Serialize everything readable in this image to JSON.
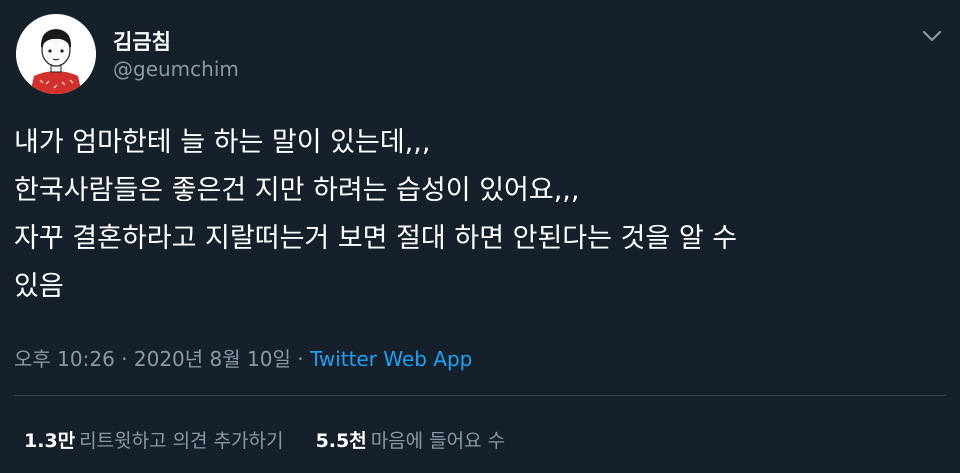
{
  "author": {
    "display_name": "김금침",
    "handle": "@geumchim"
  },
  "tweet": {
    "lines": [
      "내가 엄마한테 늘 하는 말이 있는데,,,",
      "한국사람들은 좋은건 지만 하려는 습성이 있어요,,,",
      "자꾸 결혼하라고 지랄떠는거 보면 절대 하면 안된다는 것을 알 수",
      "있음"
    ]
  },
  "meta": {
    "time": "오후 10:26",
    "separator": "·",
    "date": "2020년 8월 10일",
    "source": "Twitter Web App"
  },
  "stats": {
    "retweets_count": "1.3만",
    "retweets_label": "리트윗하고 의견 추가하기",
    "likes_count": "5.5천",
    "likes_label": "마음에 들어요 수"
  },
  "icons": {
    "menu": "chevron-down-icon",
    "avatar": "avatar"
  },
  "colors": {
    "background": "#15202b",
    "text": "#ffffff",
    "secondary": "#8899a6",
    "link": "#1da1f2",
    "divider": "#38444d"
  }
}
